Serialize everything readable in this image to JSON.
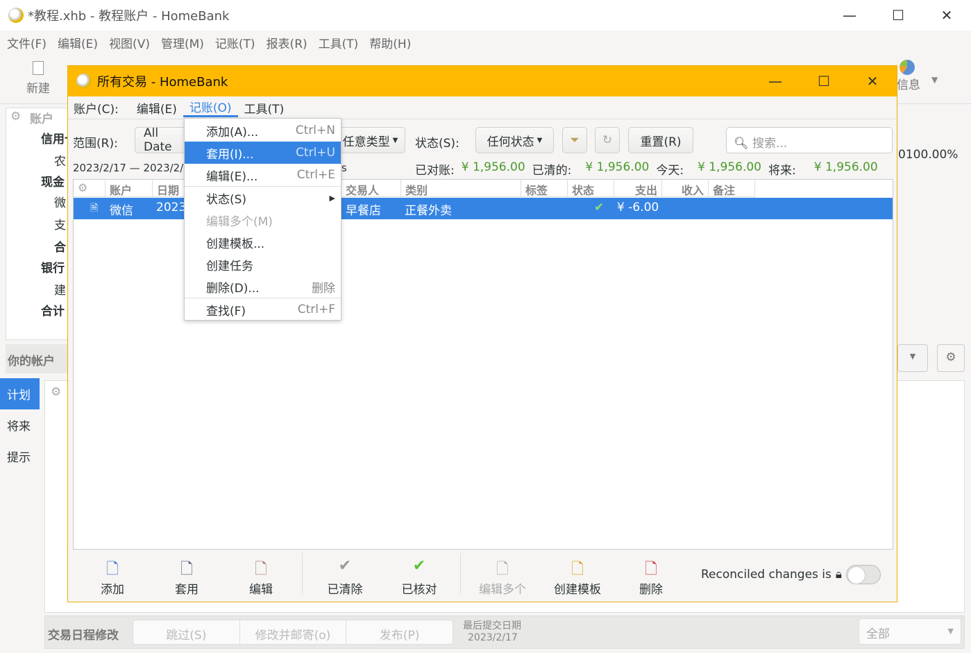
{
  "main": {
    "title": "*教程.xhb - 教程账户 - HomeBank",
    "menu": [
      "文件(F)",
      "编辑(E)",
      "视图(V)",
      "管理(M)",
      "记账(T)",
      "报表(R)",
      "工具(T)",
      "帮助(H)"
    ],
    "toolbar": {
      "new": "新建",
      "info": "信息"
    },
    "accounts": {
      "header": "账户",
      "groups": [
        "信用卡",
        "农",
        "现金",
        "微",
        "支",
        "合",
        "银行",
        "建",
        "合计"
      ],
      "footer": "你的帐户",
      "percent": "0100.00%"
    },
    "lower_tabs": [
      "计划",
      "将来",
      "提示"
    ],
    "schedule": {
      "label": "交易日程修改",
      "skip": "跳过(S)",
      "edit_post": "修改并邮寄(o)",
      "post": "发布(P)",
      "last_label": "最后提交日期",
      "last_date": "2023/2/17",
      "filter": "全部"
    }
  },
  "dialog": {
    "title": "所有交易 - HomeBank",
    "menu": [
      "账户(C):",
      "编辑(E)",
      "记账(O)",
      "工具(T)"
    ],
    "filter": {
      "range_label": "范围(R):",
      "range_value": "All Date",
      "type_value": "任意类型",
      "status_label": "状态(S):",
      "status_value": "任何状态",
      "reset": "重置(R)",
      "search_placeholder": "搜索..."
    },
    "summary": {
      "dates": "2023/2/17 — 2023/2/1",
      "suffix": "s",
      "reconciled_label": "已对账:",
      "reconciled": "¥ 1,956.00",
      "cleared_label": "已清的:",
      "cleared": "¥ 1,956.00",
      "today_label": "今天:",
      "today": "¥ 1,956.00",
      "future_label": "将来:",
      "future": "¥ 1,956.00"
    },
    "columns": [
      "账户",
      "日期",
      "交易人",
      "类别",
      "标签",
      "状态",
      "支出",
      "收入",
      "备注"
    ],
    "rows": [
      {
        "account": "微信",
        "date": "2023",
        "payee": "早餐店",
        "category": "正餐外卖",
        "status": "✔",
        "expense": "¥ -6.00"
      }
    ],
    "buttons": [
      "添加",
      "套用",
      "编辑",
      "已清除",
      "已核对",
      "编辑多个",
      "创建模板",
      "删除"
    ],
    "reconciled_toggle": "Reconciled changes is",
    "dropdown": [
      {
        "label": "添加(A)...",
        "shortcut": "Ctrl+N"
      },
      {
        "label": "套用(I)...",
        "shortcut": "Ctrl+U"
      },
      {
        "label": "编辑(E)...",
        "shortcut": "Ctrl+E"
      },
      {
        "label": "状态(S)",
        "shortcut": ""
      },
      {
        "label": "编辑多个(M)",
        "shortcut": ""
      },
      {
        "label": "创建模板...",
        "shortcut": ""
      },
      {
        "label": "创建任务",
        "shortcut": ""
      },
      {
        "label": "删除(D)...",
        "shortcut": "删除"
      },
      {
        "label": "查找(F)",
        "shortcut": "Ctrl+F"
      }
    ]
  },
  "colors": {
    "title_accent": "#ffb900",
    "selection": "#3584e4",
    "amount_green": "#4a9a2a"
  }
}
